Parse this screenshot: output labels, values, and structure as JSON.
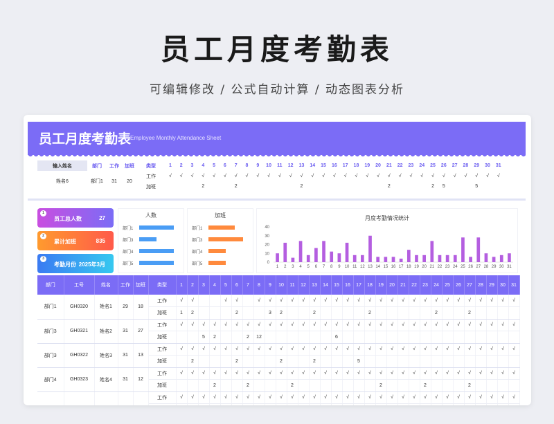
{
  "hero": {
    "title": "员工月度考勤表",
    "subtitle": "可编辑修改 /  公式自动计算  /  动态图表分析"
  },
  "banner": {
    "title": "员工月度考勤表",
    "subtitle": "Employee Monthly Attendance Sheet"
  },
  "days": [
    "1",
    "2",
    "3",
    "4",
    "5",
    "6",
    "7",
    "8",
    "9",
    "10",
    "11",
    "12",
    "13",
    "14",
    "15",
    "16",
    "17",
    "18",
    "19",
    "20",
    "21",
    "22",
    "23",
    "24",
    "25",
    "26",
    "27",
    "28",
    "29",
    "30",
    "31"
  ],
  "input_table": {
    "headers": {
      "name": "输入姓名",
      "dept": "部门",
      "work": "工作",
      "overtime": "加班",
      "type": "类型"
    },
    "row": {
      "name": "姓名6",
      "dept": "部门1",
      "work": "31",
      "overtime": "20"
    },
    "type_work": "工作",
    "type_overtime": "加班",
    "work_marks": [
      "√",
      "√",
      "√",
      "√",
      "√",
      "√",
      "√",
      "√",
      "√",
      "√",
      "√",
      "√",
      "√",
      "√",
      "√",
      "√",
      "√",
      "√",
      "√",
      "√",
      "√",
      "√",
      "√",
      "√",
      "√",
      "√",
      "√",
      "√",
      "√",
      "√",
      "√"
    ],
    "overtime_marks": [
      "",
      "",
      "",
      "2",
      "",
      "",
      "2",
      "",
      "",
      "",
      "",
      "",
      "2",
      "",
      "",
      "",
      "",
      "",
      "",
      "",
      "2",
      "",
      "",
      "",
      "2",
      "5",
      "",
      "",
      "5",
      "",
      ""
    ]
  },
  "stats": [
    {
      "num": "1",
      "label": "员工总人数",
      "value": "27"
    },
    {
      "num": "2",
      "label": "累计加班",
      "value": "835"
    },
    {
      "num": "3",
      "label": "考勤月份",
      "value": "2025年3月"
    }
  ],
  "headcount_chart": {
    "title": "人数",
    "categories": [
      "部门1",
      "部门3",
      "部门4",
      "部门5"
    ],
    "values": [
      8,
      4,
      8,
      8
    ],
    "color": "#4a9df5"
  },
  "overtime_chart": {
    "title": "加班",
    "categories": [
      "部门1",
      "部门3",
      "部门4",
      "部门5"
    ],
    "values": [
      6,
      8,
      4,
      4
    ],
    "color": "#ff8a3d"
  },
  "chart_data": {
    "type": "bar",
    "title": "月度考勤情况统计",
    "categories": [
      "1",
      "2",
      "3",
      "4",
      "5",
      "6",
      "7",
      "8",
      "9",
      "10",
      "11",
      "12",
      "13",
      "14",
      "15",
      "16",
      "17",
      "18",
      "19",
      "20",
      "21",
      "22",
      "23",
      "24",
      "25",
      "26",
      "27",
      "28",
      "29",
      "30",
      "31"
    ],
    "values": [
      10,
      22,
      5,
      24,
      8,
      16,
      24,
      12,
      10,
      22,
      8,
      8,
      30,
      6,
      6,
      6,
      4,
      14,
      8,
      8,
      24,
      8,
      8,
      8,
      28,
      6,
      28,
      10,
      6,
      8,
      10
    ],
    "ylim": [
      0,
      40
    ],
    "yticks": [
      "0",
      "10",
      "20",
      "30",
      "40"
    ],
    "color": "#b45ee0"
  },
  "main_table": {
    "headers": {
      "dept": "部门",
      "id": "工号",
      "name": "姓名",
      "work": "工作",
      "overtime": "加班",
      "type": "类型"
    },
    "type_work": "工作",
    "type_overtime": "加班",
    "rows": [
      {
        "dept": "部门1",
        "id": "GH0320",
        "name": "姓名1",
        "work": "29",
        "overtime": "18",
        "w": [
          "√",
          "√",
          "",
          "",
          "√",
          "√",
          "",
          "√",
          "√",
          "√",
          "√",
          "√",
          "√",
          "√",
          "√",
          "√",
          "√",
          "√",
          "√",
          "√",
          "√",
          "√",
          "√",
          "√",
          "√",
          "√",
          "√",
          "√",
          "√",
          "√",
          "√"
        ],
        "o": [
          "1",
          "2",
          "",
          "",
          "",
          "2",
          "",
          "",
          "3",
          "2",
          "",
          "",
          "2",
          "",
          "",
          "",
          "",
          "2",
          "",
          "",
          "",
          "",
          "",
          "2",
          "",
          "",
          "2",
          "",
          "",
          "",
          ""
        ]
      },
      {
        "dept": "部门3",
        "id": "GH0321",
        "name": "姓名2",
        "work": "31",
        "overtime": "27",
        "w": [
          "√",
          "√",
          "√",
          "√",
          "√",
          "√",
          "√",
          "√",
          "√",
          "√",
          "√",
          "√",
          "√",
          "√",
          "√",
          "√",
          "√",
          "√",
          "√",
          "√",
          "√",
          "√",
          "√",
          "√",
          "√",
          "√",
          "√",
          "√",
          "√",
          "√",
          "√"
        ],
        "o": [
          "",
          "",
          "5",
          "2",
          "",
          "",
          "2",
          "12",
          "",
          "",
          "",
          "",
          "",
          "",
          "6",
          "",
          "",
          "",
          "",
          "",
          "",
          "",
          "",
          "",
          "",
          "",
          "",
          "",
          "",
          "",
          ""
        ]
      },
      {
        "dept": "部门3",
        "id": "GH0322",
        "name": "姓名3",
        "work": "31",
        "overtime": "13",
        "w": [
          "√",
          "√",
          "√",
          "√",
          "√",
          "√",
          "√",
          "√",
          "√",
          "√",
          "√",
          "√",
          "√",
          "√",
          "√",
          "√",
          "√",
          "√",
          "√",
          "√",
          "√",
          "√",
          "√",
          "√",
          "√",
          "√",
          "√",
          "√",
          "√",
          "√",
          "√"
        ],
        "o": [
          "",
          "2",
          "",
          "",
          "",
          "2",
          "",
          "",
          "",
          "2",
          "",
          "",
          "2",
          "",
          "",
          "",
          "5",
          "",
          "",
          "",
          "",
          "",
          "",
          "",
          "",
          "",
          "",
          "",
          "",
          "",
          ""
        ]
      },
      {
        "dept": "部门4",
        "id": "GH0323",
        "name": "姓名4",
        "work": "31",
        "overtime": "12",
        "w": [
          "√",
          "√",
          "√",
          "√",
          "√",
          "√",
          "√",
          "√",
          "√",
          "√",
          "√",
          "√",
          "√",
          "√",
          "√",
          "√",
          "√",
          "√",
          "√",
          "√",
          "√",
          "√",
          "√",
          "√",
          "√",
          "√",
          "√",
          "√",
          "√",
          "√",
          "√"
        ],
        "o": [
          "",
          "",
          "",
          "2",
          "",
          "",
          "2",
          "",
          "",
          "",
          "2",
          "",
          "",
          "",
          "",
          "",
          "",
          "",
          "2",
          "",
          "",
          "",
          "2",
          "",
          "",
          "",
          "2",
          "",
          "",
          "",
          ""
        ]
      },
      {
        "dept": "",
        "id": "",
        "name": "",
        "work": "",
        "overtime": "",
        "w": [
          "√",
          "√",
          "√",
          "√",
          "√",
          "√",
          "√",
          "√",
          "√",
          "√",
          "√",
          "√",
          "√",
          "√",
          "√",
          "√",
          "√",
          "√",
          "√",
          "√",
          "√",
          "√",
          "√",
          "√",
          "√",
          "√",
          "√",
          "√",
          "√",
          "√",
          "√"
        ],
        "o": []
      }
    ]
  }
}
